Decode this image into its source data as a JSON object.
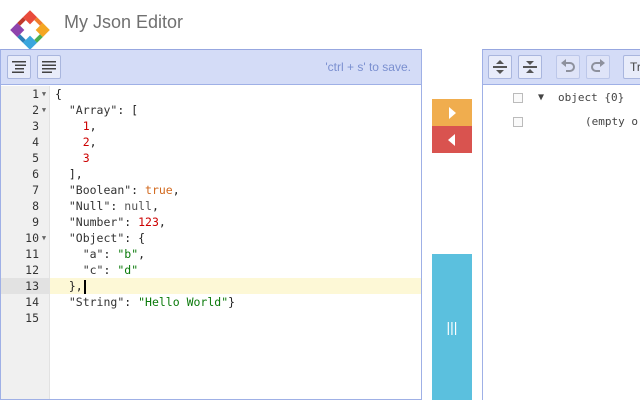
{
  "app": {
    "title": "My Json Editor"
  },
  "left_panel": {
    "save_hint": "'ctrl + s' to save.",
    "toolbar": [
      {
        "icon": "format-icon"
      },
      {
        "icon": "compact-icon"
      }
    ],
    "active_line": 13,
    "lines": [
      {
        "n": "1",
        "fold": true
      },
      {
        "n": "2",
        "fold": true
      },
      {
        "n": "3",
        "fold": false
      },
      {
        "n": "4",
        "fold": false
      },
      {
        "n": "5",
        "fold": false
      },
      {
        "n": "6",
        "fold": false
      },
      {
        "n": "7",
        "fold": false
      },
      {
        "n": "8",
        "fold": false
      },
      {
        "n": "9",
        "fold": false
      },
      {
        "n": "10",
        "fold": true
      },
      {
        "n": "11",
        "fold": false
      },
      {
        "n": "12",
        "fold": false
      },
      {
        "n": "13",
        "fold": false
      },
      {
        "n": "14",
        "fold": false
      },
      {
        "n": "15",
        "fold": false
      }
    ],
    "json_text": {
      "open_brace": "{",
      "array_key": "\"Array\"",
      "array_vals": [
        "1",
        "2",
        "3"
      ],
      "boolean_key": "\"Boolean\"",
      "boolean_val": "true",
      "null_key": "\"Null\"",
      "null_val": "null",
      "number_key": "\"Number\"",
      "number_val": "123",
      "object_key": "\"Object\"",
      "a_key": "\"a\"",
      "a_val": "\"b\"",
      "c_key": "\"c\"",
      "c_val": "\"d\"",
      "string_key": "\"String\"",
      "string_val": "\"Hello World\""
    }
  },
  "middle": {
    "drag_label": "|||"
  },
  "right_panel": {
    "mode_label": "Tr",
    "tree": [
      {
        "label": "object {0}",
        "expand": "▼"
      },
      {
        "label": "(empty o",
        "expand": ""
      }
    ]
  },
  "colors": {
    "toolbar_bg": "#d4dcf7",
    "copy_right": "#f0ad4e",
    "copy_left": "#d9534f",
    "drag_handle": "#5bc0de",
    "string": "#0b7a0b",
    "number": "#cc0000",
    "boolean": "#d2691e"
  }
}
